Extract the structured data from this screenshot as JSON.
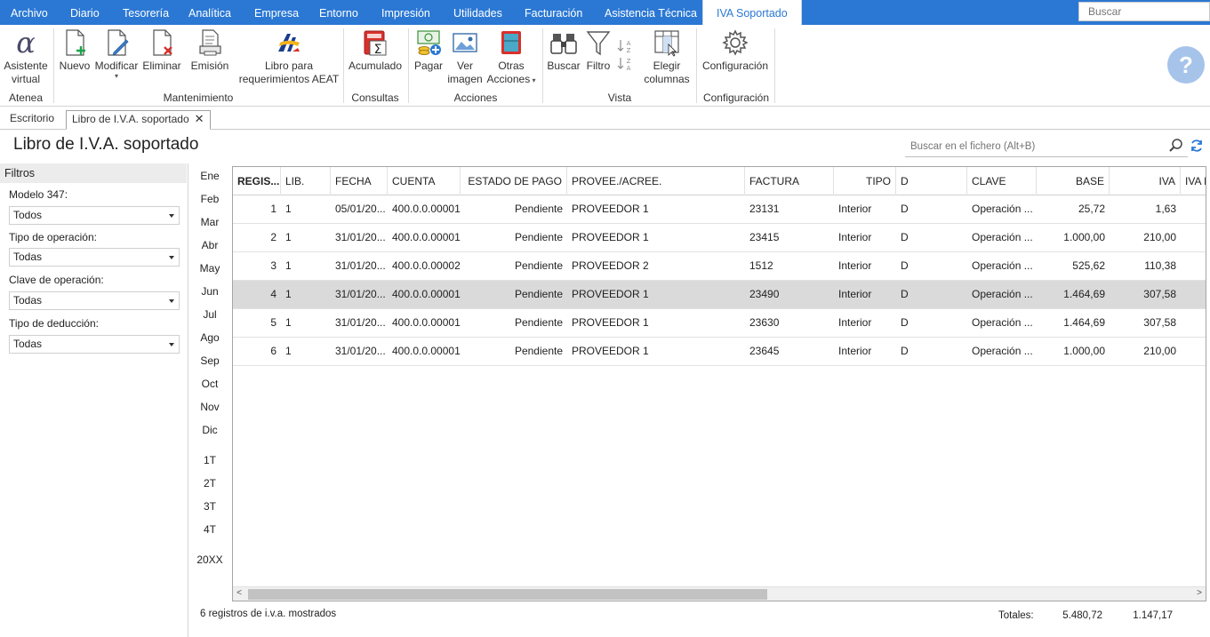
{
  "menu": {
    "items": [
      "Archivo",
      "Diario",
      "Tesorería",
      "Analítica",
      "Empresa",
      "Entorno",
      "Impresión",
      "Utilidades",
      "Facturación",
      "Asistencia Técnica"
    ],
    "active": "IVA Soportado",
    "search_placeholder": "Buscar"
  },
  "ribbon": {
    "buttons": {
      "asistente": "Asistente virtual",
      "nuevo": "Nuevo",
      "modificar": "Modificar",
      "eliminar": "Eliminar",
      "emision": "Emisión",
      "libro": "Libro para requerimientos AEAT",
      "acumulado": "Acumulado",
      "pagar": "Pagar",
      "ver_imagen": "Ver imagen",
      "otras_acciones": "Otras Acciones",
      "buscar": "Buscar",
      "filtro": "Filtro",
      "elegir_columnas": "Elegir columnas",
      "configuracion": "Configuración"
    },
    "groups": {
      "atenea": "Atenea",
      "mantenimiento": "Mantenimiento",
      "consultas": "Consultas",
      "acciones": "Acciones",
      "vista": "Vista",
      "configuracion": "Configuración"
    }
  },
  "tabs": {
    "escritorio": "Escritorio",
    "libro": "Libro de I.V.A. soportado"
  },
  "page": {
    "title": "Libro de I.V.A. soportado",
    "search_placeholder": "Buscar en el fichero (Alt+B)"
  },
  "filters": {
    "title": "Filtros",
    "modelo_label": "Modelo 347:",
    "modelo_value": "Todos",
    "operacion_label": "Tipo de operación:",
    "operacion_value": "Todas",
    "clave_label": "Clave de operación:",
    "clave_value": "Todas",
    "deduccion_label": "Tipo de deducción:",
    "deduccion_value": "Todas"
  },
  "periods": [
    "Ene",
    "Feb",
    "Mar",
    "Abr",
    "May",
    "Jun",
    "Jul",
    "Ago",
    "Sep",
    "Oct",
    "Nov",
    "Dic",
    "1T",
    "2T",
    "3T",
    "4T",
    "20XX"
  ],
  "table": {
    "columns": [
      "REGIS...",
      "LIB.",
      "FECHA",
      "CUENTA",
      "ESTADO DE PAGO",
      "PROVEE./ACREE.",
      "FACTURA",
      "TIPO",
      "D",
      "CLAVE",
      "BASE",
      "IVA",
      "IVA D"
    ],
    "rows": [
      [
        "1",
        "1",
        "05/01/20...",
        "400.0.0.00001",
        "Pendiente",
        "PROVEEDOR 1",
        "23131",
        "Interior",
        "D",
        "Operación ...",
        "25,72",
        "1,63"
      ],
      [
        "2",
        "1",
        "31/01/20...",
        "400.0.0.00001",
        "Pendiente",
        "PROVEEDOR 1",
        "23415",
        "Interior",
        "D",
        "Operación ...",
        "1.000,00",
        "210,00"
      ],
      [
        "3",
        "1",
        "31/01/20...",
        "400.0.0.00002",
        "Pendiente",
        "PROVEEDOR 2",
        "1512",
        "Interior",
        "D",
        "Operación ...",
        "525,62",
        "110,38"
      ],
      [
        "4",
        "1",
        "31/01/20...",
        "400.0.0.00001",
        "Pendiente",
        "PROVEEDOR 1",
        "23490",
        "Interior",
        "D",
        "Operación ...",
        "1.464,69",
        "307,58"
      ],
      [
        "5",
        "1",
        "31/01/20...",
        "400.0.0.00001",
        "Pendiente",
        "PROVEEDOR 1",
        "23630",
        "Interior",
        "D",
        "Operación ...",
        "1.464,69",
        "307,58"
      ],
      [
        "6",
        "1",
        "31/01/20...",
        "400.0.0.00001",
        "Pendiente",
        "PROVEEDOR 1",
        "23645",
        "Interior",
        "D",
        "Operación ...",
        "1.000,00",
        "210,00"
      ]
    ],
    "selected_row": 4
  },
  "footer": {
    "status": "6 registros de i.v.a. mostrados",
    "totals_label": "Totales:",
    "total_base": "5.480,72",
    "total_iva": "1.147,17"
  },
  "colors": {
    "menubar": "#2b78d4",
    "selected_row": "#dadada",
    "help": "#a6c3ea"
  }
}
